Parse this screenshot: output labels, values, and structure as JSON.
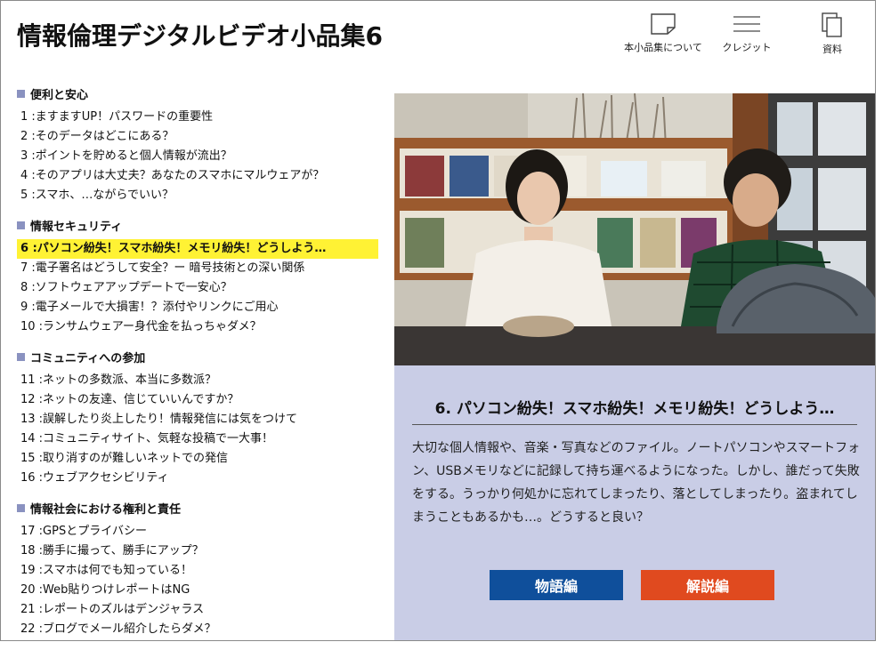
{
  "app": {
    "title": "情報倫理デジタルビデオ小品集6"
  },
  "nav": {
    "about_label": "本小品集について",
    "credits_label": "クレジット",
    "materials_label": "資料"
  },
  "sections": [
    {
      "title": "便利と安心",
      "items": [
        "1 :ますますUP！パスワードの重要性",
        "2 :そのデータはどこにある？",
        "3 :ポイントを貯めると個人情報が流出？",
        "4 :そのアプリは大丈夫？あなたのスマホにマルウェアが？",
        "5 :スマホ、…ながらでいい？"
      ]
    },
    {
      "title": "情報セキュリティ",
      "items": [
        "6 :パソコン紛失！スマホ紛失！メモリ紛失！どうしよう…",
        "7 :電子署名はどうして安全？ー 暗号技術との深い関係",
        "8 :ソフトウェアアップデートで一安心？",
        "9 :電子メールで大損害！？添付やリンクにご用心",
        "10 :ランサムウェアー身代金を払っちゃダメ？"
      ]
    },
    {
      "title": "コミュニティへの参加",
      "items": [
        "11 :ネットの多数派、本当に多数派？",
        "12 :ネットの友達、信じていいんですか？",
        "13 :誤解したり炎上したり！情報発信には気をつけて",
        "14 :コミュニティサイト、気軽な投稿で一大事！",
        "15 :取り消すのが難しいネットでの発信",
        "16 :ウェブアクセシビリティ"
      ]
    },
    {
      "title": "情報社会における権利と責任",
      "items": [
        "17 :GPSとプライバシー",
        "18 :勝手に撮って、勝手にアップ？",
        "19 :スマホは何でも知っている！",
        "20 :Web貼りつけレポートはNG",
        "21 :レポートのズルはデンジャラス",
        "22 :ブログでメール紹介したらダメ？"
      ]
    }
  ],
  "selected_episode": 6,
  "detail": {
    "title": "6. パソコン紛失！スマホ紛失！メモリ紛失！どうしよう…",
    "description": "大切な個人情報や、音楽・写真などのファイル。ノートパソコンやスマートフォン、USBメモリなどに記録して持ち運べるようになった。しかし、誰だって失敗をする。うっかり何処かに忘れてしまったり、落としてしまったり。盗まれてしまうこともあるかも…。どうすると良い？",
    "story_button": "物語編",
    "commentary_button": "解説編"
  },
  "colors": {
    "accent_panel": "#c9cde6",
    "highlight": "#fff234",
    "section_marker": "#8a92c0",
    "story_button": "#0f4f9b",
    "commentary_button": "#e04a1f"
  },
  "icons": {
    "about": "note-page-icon",
    "credits": "hamburger-lines-icon",
    "materials": "stacked-documents-icon"
  }
}
